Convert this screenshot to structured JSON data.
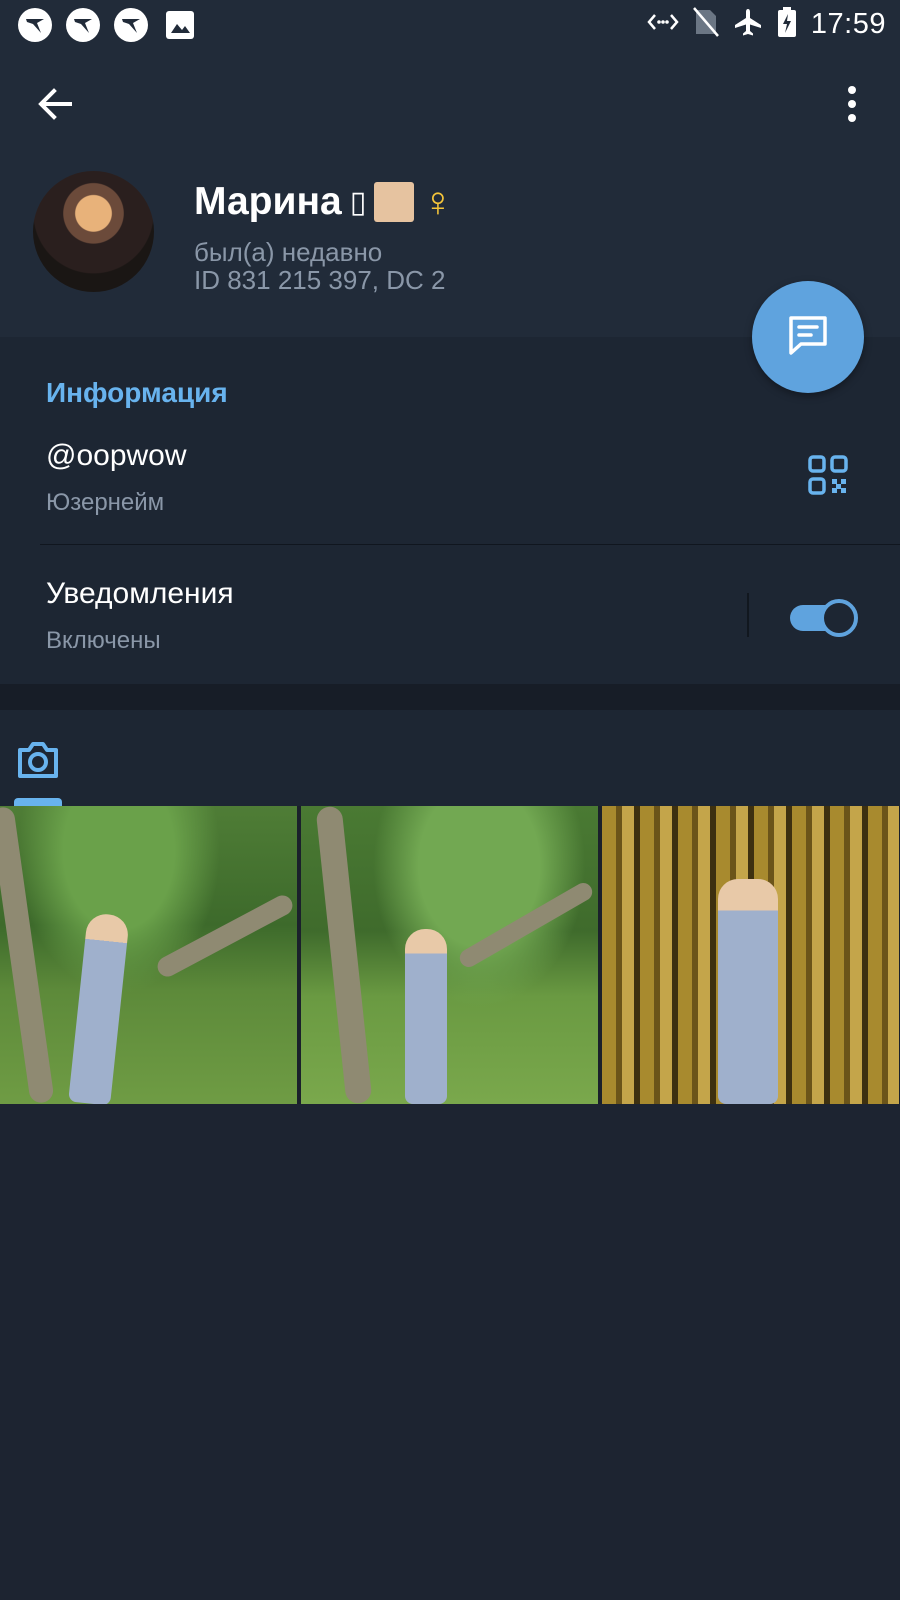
{
  "status_bar": {
    "time": "17:59",
    "left_icons": [
      "app-bird-icon",
      "app-bird-icon",
      "app-bird-icon",
      "image-icon"
    ],
    "right_icons": [
      "data-saver-icon",
      "no-sim-icon",
      "airplane-mode-icon",
      "battery-charging-icon"
    ]
  },
  "header": {
    "back_icon": "arrow-left-icon",
    "menu_icon": "more-vertical-icon",
    "name": "Марина",
    "name_tofu": "▯",
    "gender_symbol": "♀",
    "status": "был(а) недавно",
    "id_line": "ID 831 215 397, DC 2",
    "fab_icon": "message-icon"
  },
  "info": {
    "title": "Информация",
    "username_value": "@oopwow",
    "username_label": "Юзернейм",
    "qr_icon": "qr-code-icon",
    "notifications_value": "Уведомления",
    "notifications_label": "Включены",
    "notifications_enabled": true
  },
  "media": {
    "tabs": [
      {
        "icon": "camera-icon",
        "active": true
      }
    ],
    "photos": [
      "photo-park-1",
      "photo-park-2",
      "photo-bamboo"
    ]
  },
  "colors": {
    "accent": "#5fa3de",
    "accent_text": "#68b3ee",
    "background": "#1d2431",
    "header_bg": "#212b39",
    "secondary_text": "#8a97a8",
    "gender_symbol": "#f5c53a"
  }
}
